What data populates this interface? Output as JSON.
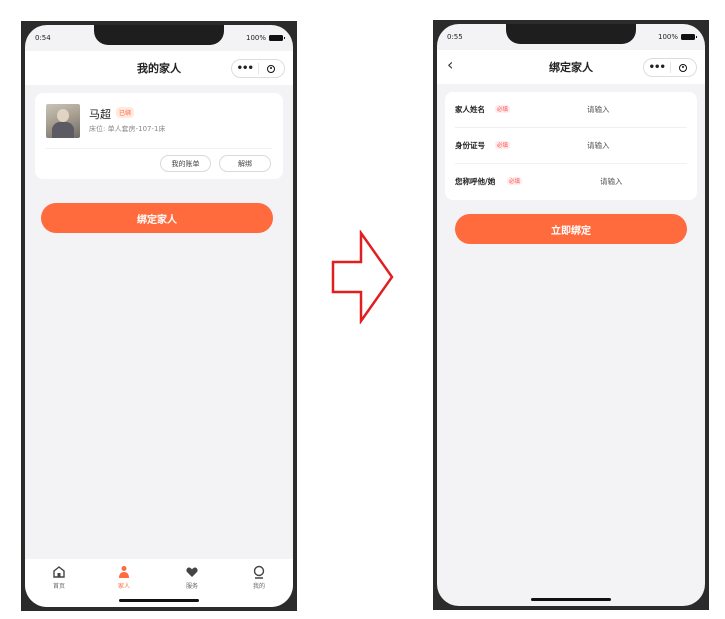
{
  "left_screen": {
    "status_time": "0:54",
    "battery": "100%",
    "title": "我的家人",
    "member": {
      "name": "马超",
      "tag": "已绑",
      "bed": "床位: 单人套房-107-1床"
    },
    "bill_button": "我的账单",
    "unbind_button": "解绑",
    "bind_button": "绑定家人",
    "tabs": [
      {
        "label": "首页",
        "icon": "home-icon"
      },
      {
        "label": "家人",
        "icon": "family-icon"
      },
      {
        "label": "服务",
        "icon": "service-icon"
      },
      {
        "label": "我的",
        "icon": "profile-icon"
      }
    ]
  },
  "right_screen": {
    "status_time": "0:55",
    "battery": "100%",
    "title": "绑定家人",
    "fields": [
      {
        "label": "家人姓名",
        "required": "必填",
        "placeholder": "请输入"
      },
      {
        "label": "身份证号",
        "required": "必填",
        "placeholder": "请输入"
      },
      {
        "label": "您称呼他/她",
        "required": "必填",
        "placeholder": "请输入"
      }
    ],
    "submit_button": "立即绑定"
  },
  "colors": {
    "accent": "#ff6b3d",
    "arrow": "#e02020",
    "page_bg": "#f3f3f6"
  }
}
